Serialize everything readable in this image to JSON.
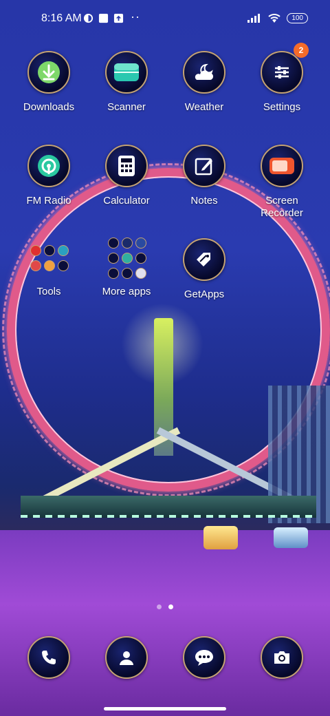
{
  "status_bar": {
    "time": "8:16 AM",
    "battery": "100",
    "overflow": "··"
  },
  "apps": [
    {
      "label": "Downloads",
      "icon": "download-icon"
    },
    {
      "label": "Scanner",
      "icon": "scanner-icon"
    },
    {
      "label": "Weather",
      "icon": "weather-icon"
    },
    {
      "label": "Settings",
      "icon": "settings-icon",
      "badge": "2"
    },
    {
      "label": "FM Radio",
      "icon": "radio-icon"
    },
    {
      "label": "Calculator",
      "icon": "calculator-icon"
    },
    {
      "label": "Notes",
      "icon": "notes-icon"
    },
    {
      "label": "Screen\nRecorder",
      "icon": "screen-recorder-icon"
    },
    {
      "label": "Tools",
      "icon": "folder-icon"
    },
    {
      "label": "More apps",
      "icon": "folder-icon"
    },
    {
      "label": "GetApps",
      "icon": "getapps-icon"
    }
  ],
  "dock": [
    {
      "icon": "phone-icon"
    },
    {
      "icon": "contacts-icon"
    },
    {
      "icon": "messages-icon"
    },
    {
      "icon": "camera-icon"
    }
  ],
  "page_indicator": {
    "pages": 2,
    "current": 2
  },
  "colors": {
    "badge": "#f46b2a",
    "icon_ring": "#c4a272",
    "icon_bg": "#06082a"
  }
}
